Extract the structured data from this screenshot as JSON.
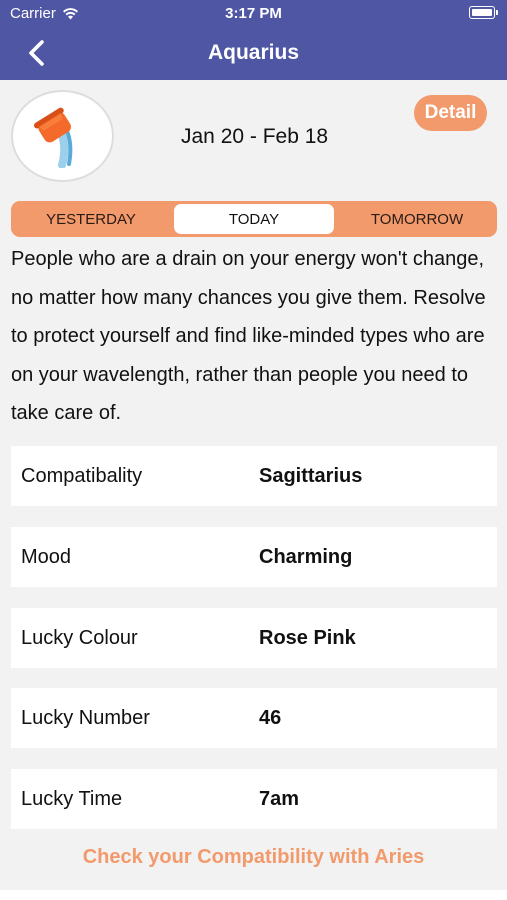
{
  "status_bar": {
    "carrier": "Carrier",
    "time": "3:17 PM"
  },
  "nav": {
    "title": "Aquarius",
    "back_icon": "chevron-left-icon"
  },
  "sign": {
    "icon": "aquarius-water-jug-icon",
    "date_range": "Jan 20 - Feb 18",
    "detail_label": "Detail"
  },
  "tabs": [
    {
      "label": "YESTERDAY",
      "active": false
    },
    {
      "label": "TODAY",
      "active": true
    },
    {
      "label": "TOMORROW",
      "active": false
    }
  ],
  "reading": "People who are a drain on your energy won't change, no matter how many chances you give them. Resolve to protect yourself and find like-minded types who are on your wavelength, rather than people you need to take care of.",
  "details": [
    {
      "label": "Compatibality",
      "value": "Sagittarius"
    },
    {
      "label": "Mood",
      "value": "Charming"
    },
    {
      "label": "Lucky Colour",
      "value": "Rose Pink"
    },
    {
      "label": "Lucky Number",
      "value": "46"
    },
    {
      "label": "Lucky Time",
      "value": "7am"
    }
  ],
  "compat_link": "Check your Compatibility with Aries",
  "colors": {
    "nav": "#4f56a4",
    "accent": "#f29a6c",
    "background": "#f2f2f2"
  }
}
